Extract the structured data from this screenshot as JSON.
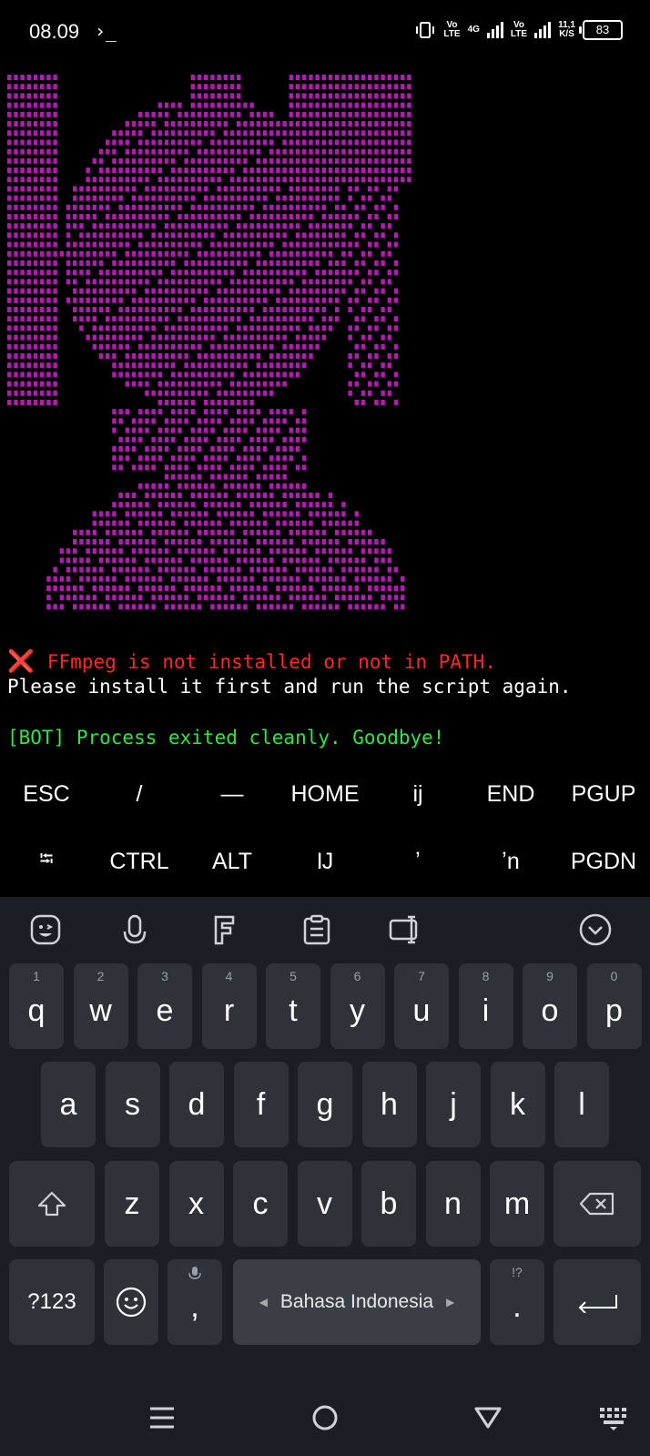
{
  "status_bar": {
    "time": "08.09",
    "terminal_glyph": "›_",
    "volte1": "Vo\nLTE",
    "network": "4G",
    "volte2": "Vo\nLTE",
    "speed_value": "11,1",
    "speed_unit": "K/S",
    "battery": "83"
  },
  "terminal": {
    "ascii_color": "#b01bb0",
    "error_icon": "❌",
    "error_text": "FFmpeg is not installed or not in PATH.",
    "info_text": "Please install it first and run the script again.",
    "bot_text": "[BOT] Process exited cleanly. Goodbye!"
  },
  "extra_keys": {
    "row1": [
      "ESC",
      "/",
      "—",
      "HOME",
      "ij",
      "END",
      "PGUP"
    ],
    "row2": [
      "⭾",
      "CTRL",
      "ALT",
      "Ĳ",
      "ʼ",
      "ʼn",
      "PGDN"
    ]
  },
  "keyboard": {
    "toolbar_icons": [
      "emoji-sticker-icon",
      "microphone-icon",
      "font-icon",
      "clipboard-icon",
      "one-handed-mode-icon",
      "collapse-keyboard-icon"
    ],
    "row1": [
      {
        "num": "1",
        "letter": "q"
      },
      {
        "num": "2",
        "letter": "w"
      },
      {
        "num": "3",
        "letter": "e"
      },
      {
        "num": "4",
        "letter": "r"
      },
      {
        "num": "5",
        "letter": "t"
      },
      {
        "num": "6",
        "letter": "y"
      },
      {
        "num": "7",
        "letter": "u"
      },
      {
        "num": "8",
        "letter": "i"
      },
      {
        "num": "9",
        "letter": "o"
      },
      {
        "num": "0",
        "letter": "p"
      }
    ],
    "row2": [
      "a",
      "s",
      "d",
      "f",
      "g",
      "h",
      "j",
      "k",
      "l"
    ],
    "row3": [
      "z",
      "x",
      "c",
      "v",
      "b",
      "n",
      "m"
    ],
    "symbols_key": "?123",
    "comma": ",",
    "period": ".",
    "period_hint": "!?",
    "space_label": "Bahasa Indonesia"
  },
  "navbar": {
    "icons": [
      "menu-icon",
      "home-icon",
      "back-icon",
      "keyboard-switch-icon"
    ]
  }
}
